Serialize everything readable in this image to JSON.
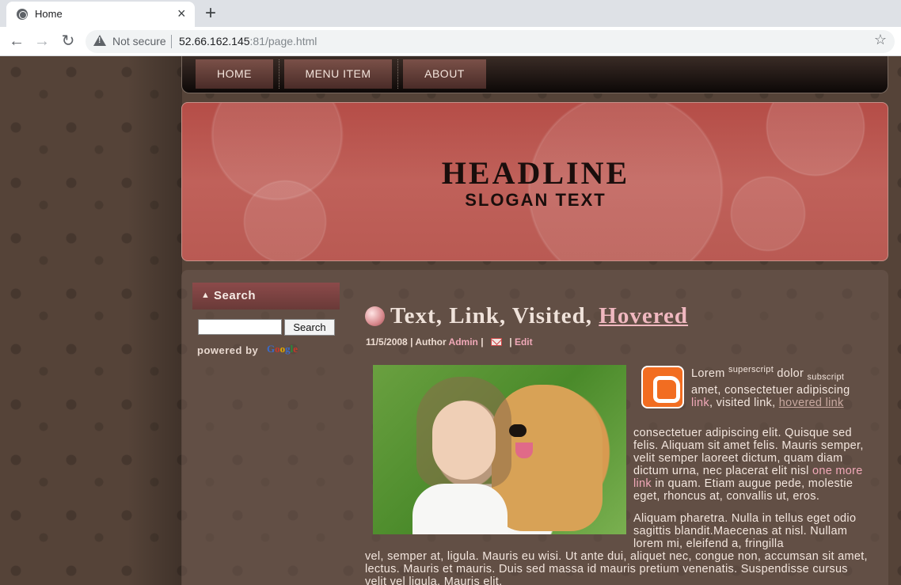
{
  "browser": {
    "tab_title": "Home",
    "tab_close": "×",
    "new_tab": "+",
    "security_label": "Not secure",
    "url_host": "52.66.162.145",
    "url_port_path": ":81/page.html"
  },
  "nav": {
    "items": [
      "HOME",
      "MENU ITEM",
      "ABOUT"
    ]
  },
  "banner": {
    "headline": "HEADLINE",
    "slogan": "SLOGAN TEXT"
  },
  "sidebar": {
    "heading": "Search",
    "search_button": "Search",
    "powered_by": "powered by",
    "google": "Google"
  },
  "post": {
    "title_plain": "Text, Link, Visited,",
    "title_hovered": "Hovered",
    "date": "11/5/2008",
    "author_label": "Author",
    "author": "Admin",
    "edit": "Edit",
    "p1_lorem": "Lorem",
    "p1_sup": "superscript",
    "p1_dolor": "dolor",
    "p1_sub": "subscript",
    "p1_text1": "amet, consectetuer adipiscing",
    "p1_link": "link",
    "p1_visited": ", visited link,",
    "p1_hovered": "hovered link",
    "p1_text2": "consectetuer adipiscing elit. Quisque sed felis. Aliquam sit amet felis. Mauris semper, velit semper laoreet dictum, quam diam dictum urna, nec placerat elit nisl",
    "p1_more": "one more link",
    "p1_text3": "in quam. Etiam augue pede, molestie eget, rhoncus at, convallis ut, eros.",
    "p2": "Aliquam pharetra. Nulla in tellus eget odio sagittis blandit.Maecenas at nisl. Nullam lorem mi, eleifend a, fringilla",
    "p2_cont": "vel, semper at, ligula. Mauris eu wisi. Ut ante dui, aliquet nec, congue non, accumsan sit amet, lectus. Mauris et mauris. Duis sed massa id mauris pretium venenatis. Suspendisse cursus velit vel ligula. Mauris elit."
  }
}
